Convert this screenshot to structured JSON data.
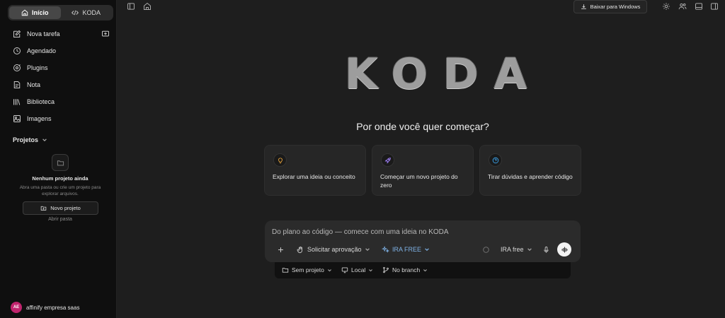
{
  "sidebar": {
    "tabs": [
      {
        "label": "Início",
        "icon": "home-icon",
        "active": true
      },
      {
        "label": "KODA",
        "icon": "code-icon",
        "active": false
      }
    ],
    "nav": [
      {
        "label": "Nova tarefa",
        "icon": "edit-icon"
      },
      {
        "label": "Agendado",
        "icon": "clock-icon"
      },
      {
        "label": "Plugins",
        "icon": "plugin-icon"
      },
      {
        "label": "Nota",
        "icon": "note-icon"
      },
      {
        "label": "Biblioteca",
        "icon": "library-icon"
      },
      {
        "label": "Imagens",
        "icon": "image-icon"
      }
    ],
    "projects": {
      "header": "Projetos",
      "empty_title": "Nenhum projeto ainda",
      "empty_desc": "Abra uma pasta ou crie um projeto para explorar arquivos.",
      "new_button": "Novo projeto",
      "open_link": "Abrir pasta"
    },
    "user": {
      "initials": "AE",
      "name": "affinify empresa saas",
      "avatar_color": "#c0246d"
    }
  },
  "topbar": {
    "download_label": "Baixar para Windows"
  },
  "main": {
    "logo": "KODA",
    "question": "Por onde você quer começar?",
    "cards": [
      {
        "text": "Explorar uma ideia ou conceito",
        "icon": "lightbulb-icon",
        "icon_color": "#e8a33a"
      },
      {
        "text": "Começar um novo projeto do zero",
        "icon": "rocket-icon",
        "icon_color": "#9a7cf0"
      },
      {
        "text": "Tirar dúvidas e aprender código",
        "icon": "help-circle-icon",
        "icon_color": "#3aa0e8"
      }
    ]
  },
  "prompt": {
    "placeholder": "Do plano ao código — comece com uma ideia no KODA",
    "approval_label": "Solicitar aprovação",
    "model_label": "IRA FREE",
    "model_right_label": "IRA free",
    "accent": "#7fb2e6"
  },
  "context_bar": {
    "project": "Sem projeto",
    "location": "Local",
    "branch": "No branch"
  }
}
